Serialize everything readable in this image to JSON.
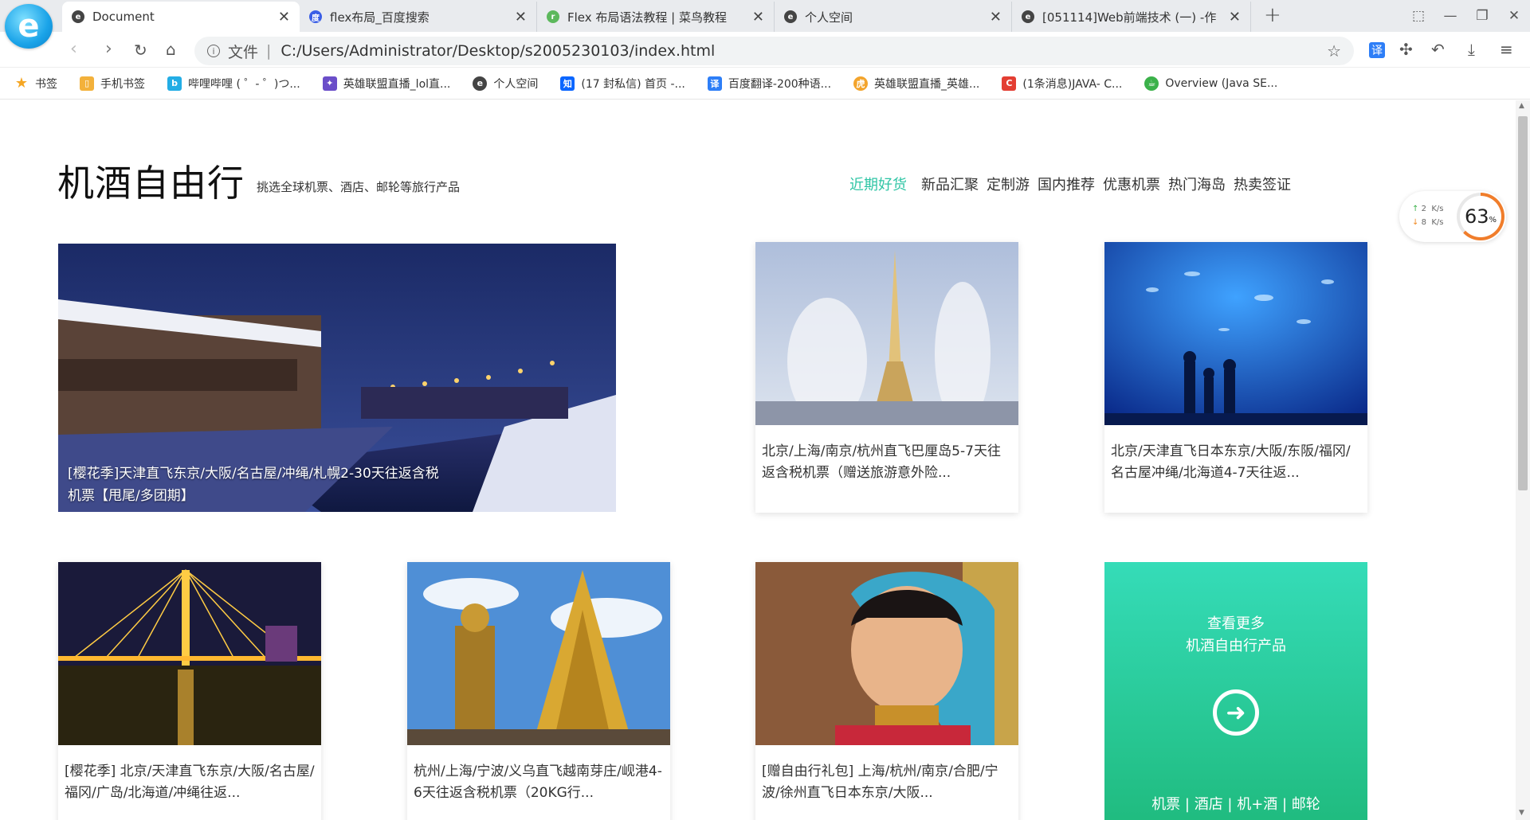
{
  "browser": {
    "tabs": [
      {
        "title": "Document",
        "active": true,
        "icon": "edge-e-icon"
      },
      {
        "title": "flex布局_百度搜索",
        "icon": "baidu-paw-icon"
      },
      {
        "title": "Flex 布局语法教程 | 菜鸟教程",
        "icon": "runoob-icon"
      },
      {
        "title": "个人空间",
        "icon": "edge-e-icon"
      },
      {
        "title": "[051114]Web前端技术 (一) -作",
        "icon": "edge-e-icon"
      }
    ],
    "address": {
      "protocol_label": "文件",
      "separator": "|",
      "url": "C:/Users/Administrator/Desktop/s2005230103/index.html"
    },
    "translate_label": "译",
    "bookmarks": [
      {
        "label": "书签",
        "icon": "star-icon",
        "color": "#f5a623"
      },
      {
        "label": "手机书签",
        "icon": "mobile-bookmark-icon",
        "color": "#f3b13b"
      },
      {
        "label": "哔哩哔哩 ( ゜- ゜)つ...",
        "icon": "bilibili-icon",
        "color": "#23ade5"
      },
      {
        "label": "英雄联盟直播_lol直...",
        "icon": "lol-icon",
        "color": "#6b4ec9"
      },
      {
        "label": "个人空间",
        "icon": "edge-e-icon",
        "color": "#444444"
      },
      {
        "label": "(17 封私信) 首页 -...",
        "icon": "zhihu-icon",
        "color": "#0a66ff"
      },
      {
        "label": "百度翻译-200种语...",
        "icon": "baidu-translate-icon",
        "color": "#2d7ef7"
      },
      {
        "label": "英雄联盟直播_英雄...",
        "icon": "huya-icon",
        "color": "#f3a42c"
      },
      {
        "label": "(1条消息)JAVA- C...",
        "icon": "csdn-icon",
        "color": "#e33e33"
      },
      {
        "label": "Overview (Java SE...",
        "icon": "java-icon",
        "color": "#3bb14a"
      }
    ]
  },
  "speed_widget": {
    "up": "2",
    "down": "8",
    "unit": "K/s",
    "percent": "63",
    "percent_sign": "%"
  },
  "page": {
    "title": "机酒自由行",
    "subtitle": "挑选全球机票、酒店、邮轮等旅行产品",
    "nav": [
      "近期好货",
      "新品汇聚",
      "定制游",
      "国内推荐",
      "优惠机票",
      "热门海岛",
      "热卖签证"
    ],
    "nav_active_color": "#2fc5a5",
    "cards": [
      {
        "caption": "[樱花季]天津直飞东京/大阪/名古屋/冲绳/札幌2-30天往返含税机票【甩尾/多团期】",
        "image": "snowy canal town at night"
      },
      {
        "caption": "北京/上海/南京/杭州直飞巴厘岛5-7天往返含税机票（赠送旅游意外险...",
        "image": "eiffel tower with fountains"
      },
      {
        "caption": "北京/天津直飞日本东京/大阪/东阪/福冈/名古屋冲绳/北海道4-7天往返...",
        "image": "aquarium tunnel with silhouettes"
      },
      {
        "caption": "[樱花季] 北京/天津直飞东京/大阪/名古屋/福冈/广岛/北海道/冲绳往返...",
        "image": "lit cable-stayed bridge at night"
      },
      {
        "caption": "杭州/上海/宁波/义乌直飞越南芽庄/岘港4-6天往返含税机票（20KG行...",
        "image": "golden temple statues"
      },
      {
        "caption": "[赠自由行礼包] 上海/杭州/南京/合肥/宁波/徐州直飞日本东京/大阪...",
        "image": "child in colorful headdress"
      }
    ],
    "more": {
      "line1": "查看更多",
      "line2": "机酒自由行产品",
      "links": "机票 | 酒店 | 机+酒 | 邮轮",
      "gradient": [
        "#35dcb8",
        "#1fba7d"
      ]
    }
  }
}
